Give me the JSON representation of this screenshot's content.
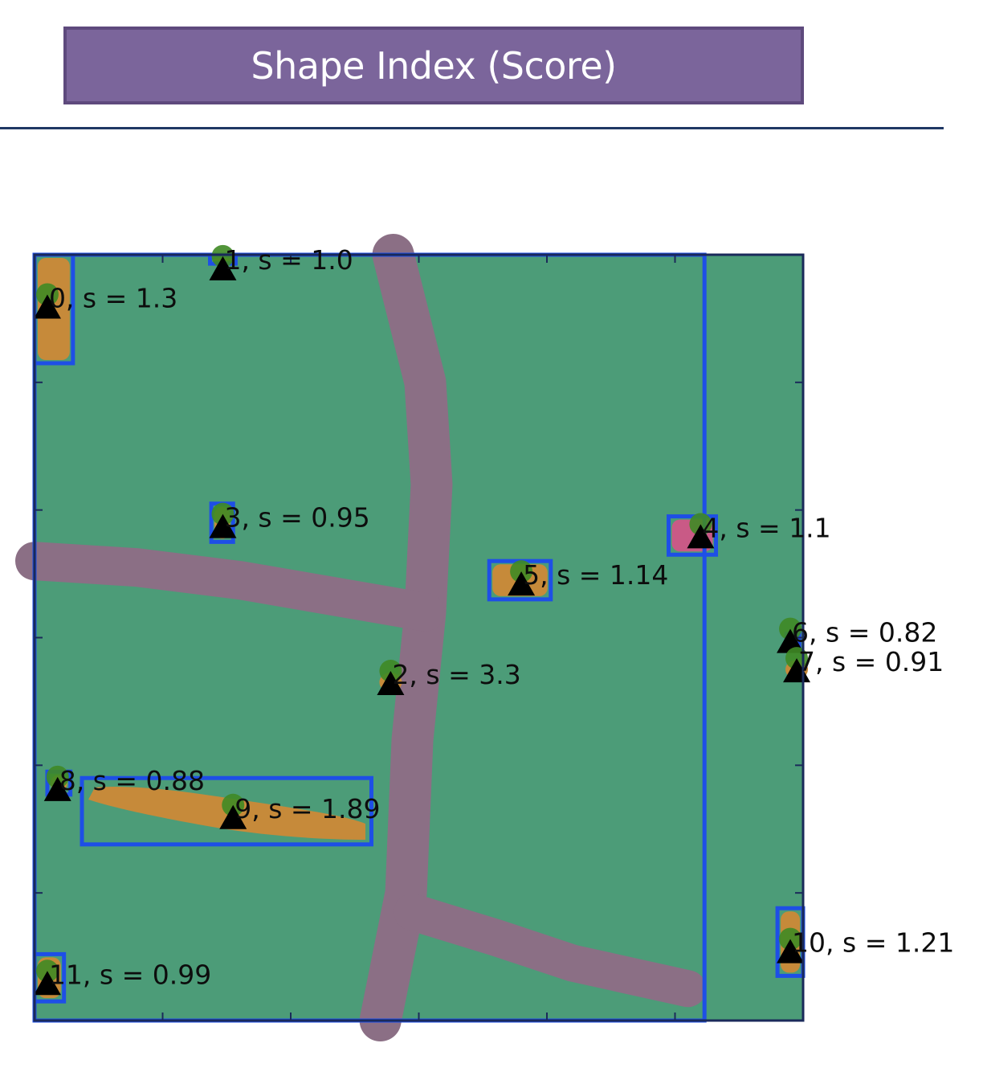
{
  "title": "Shape Index (Score)",
  "colors": {
    "banner": "#7b659b",
    "banner_border": "#5e4a7d",
    "divider": "#1f3864",
    "field": "#4c9c78",
    "road": "#8b6f85",
    "patch_orange": "#c68a3a",
    "patch_pink": "#c95a86",
    "box": "#1e4fe6",
    "centroid": "#3f8a25",
    "marker": "#000000"
  },
  "chart_data": {
    "type": "scatter",
    "title": "",
    "xlabel": "",
    "ylabel": "",
    "xlim": [
      0,
      6
    ],
    "ylim": [
      0,
      6
    ],
    "x_ticks": [
      0,
      1,
      2,
      3,
      4,
      5,
      6
    ],
    "y_ticks": [
      0,
      1,
      2,
      3,
      4,
      5,
      6
    ],
    "tick_labels_shown": false,
    "grid": false,
    "legend": "none",
    "background_region": "field",
    "roads": [
      {
        "name": "vertical-road",
        "points": [
          [
            2.8,
            6.0
          ],
          [
            3.05,
            5.0
          ],
          [
            3.1,
            4.2
          ],
          [
            3.05,
            3.2
          ],
          [
            2.95,
            2.2
          ],
          [
            2.9,
            1.0
          ],
          [
            2.7,
            0.0
          ]
        ]
      },
      {
        "name": "horizontal-road",
        "points": [
          [
            0.0,
            3.6
          ],
          [
            0.8,
            3.55
          ],
          [
            1.6,
            3.45
          ],
          [
            3.05,
            3.2
          ]
        ]
      },
      {
        "name": "diagonal-road",
        "points": [
          [
            2.95,
            0.85
          ],
          [
            3.6,
            0.65
          ],
          [
            4.2,
            0.45
          ],
          [
            5.1,
            0.25
          ]
        ]
      }
    ],
    "points": [
      {
        "id": 0,
        "label": "0, s = 1.3",
        "score": 1.3,
        "x": 0.1,
        "y": 5.55,
        "box": [
          0.0,
          5.15,
          0.3,
          6.0
        ],
        "patch": "orange"
      },
      {
        "id": 1,
        "label": "1, s = 1.0",
        "score": 1.0,
        "x": 1.47,
        "y": 5.85,
        "box": [
          1.37,
          5.93,
          1.57,
          6.0
        ],
        "patch": "orange"
      },
      {
        "id": 2,
        "label": "2, s = 3.3",
        "score": 3.3,
        "x": 2.78,
        "y": 2.6,
        "box": null,
        "patch": "orange"
      },
      {
        "id": 3,
        "label": "3, s = 0.95",
        "score": 0.95,
        "x": 1.47,
        "y": 3.83,
        "box": [
          1.38,
          3.75,
          1.55,
          4.05
        ],
        "patch": "orange"
      },
      {
        "id": 4,
        "label": "4, s = 1.1",
        "score": 1.1,
        "x": 5.2,
        "y": 3.75,
        "box": [
          4.95,
          3.65,
          5.32,
          3.95
        ],
        "patch": "pink"
      },
      {
        "id": 5,
        "label": "5, s = 1.14",
        "score": 1.14,
        "x": 3.8,
        "y": 3.38,
        "box": [
          3.55,
          3.3,
          4.03,
          3.6
        ],
        "patch": "orange"
      },
      {
        "id": 6,
        "label": "6, s = 0.82",
        "score": 0.82,
        "x": 5.9,
        "y": 2.93,
        "box": [
          5.87,
          2.9,
          5.97,
          3.03
        ],
        "patch": "orange"
      },
      {
        "id": 7,
        "label": "7, s = 0.91",
        "score": 0.91,
        "x": 5.95,
        "y": 2.7,
        "box": null,
        "patch": "orange"
      },
      {
        "id": 8,
        "label": "8, s = 0.88",
        "score": 0.88,
        "x": 0.18,
        "y": 1.77,
        "box": [
          0.1,
          1.77,
          0.28,
          1.95
        ],
        "patch": "orange"
      },
      {
        "id": 9,
        "label": "9, s = 1.89",
        "score": 1.89,
        "x": 1.55,
        "y": 1.55,
        "box": [
          0.37,
          1.38,
          2.63,
          1.9
        ],
        "patch": "orange"
      },
      {
        "id": 10,
        "label": "10, s = 1.21",
        "score": 1.21,
        "x": 5.9,
        "y": 0.5,
        "box": [
          5.8,
          0.35,
          6.0,
          0.88
        ],
        "patch": "orange"
      },
      {
        "id": 11,
        "label": "11, s = 0.99",
        "score": 0.99,
        "x": 0.1,
        "y": 0.25,
        "box": [
          0.0,
          0.15,
          0.23,
          0.52
        ],
        "patch": "orange"
      }
    ],
    "large_box": [
      0.0,
      0.0,
      5.23,
      6.0
    ]
  }
}
